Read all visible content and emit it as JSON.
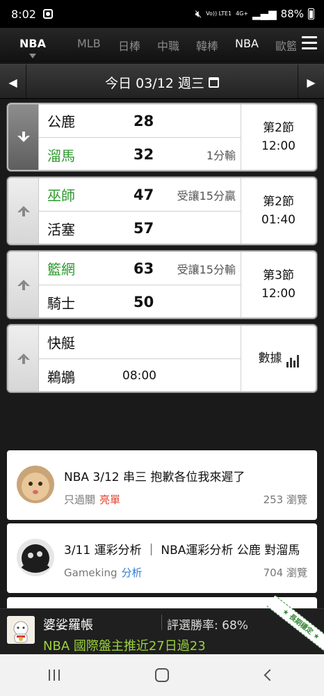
{
  "status_bar": {
    "time": "8:02",
    "volte": "Vo)) LTE1",
    "network": "4G+",
    "battery": "88%"
  },
  "league_tabs": [
    "NBA",
    "MLB",
    "日棒",
    "中職",
    "韓棒",
    "NBA",
    "歐籃"
  ],
  "date_bar": {
    "label": "今日 03/12 週三"
  },
  "games": [
    {
      "arrow": "down",
      "top": {
        "name": "公鹿",
        "score": "28",
        "note": "",
        "color": "#111111"
      },
      "bottom": {
        "name": "溜馬",
        "score": "32",
        "note": "1分輸",
        "color": "#2f9a2f"
      },
      "status_line1": "第2節",
      "status_line2": "12:00"
    },
    {
      "arrow": "up",
      "top": {
        "name": "巫師",
        "score": "47",
        "note": "受讓15分贏",
        "color": "#2f9a2f"
      },
      "bottom": {
        "name": "活塞",
        "score": "57",
        "note": "",
        "color": "#111111"
      },
      "status_line1": "第2節",
      "status_line2": "01:40"
    },
    {
      "arrow": "up",
      "top": {
        "name": "籃網",
        "score": "63",
        "note": "受讓15分輸",
        "color": "#2f9a2f"
      },
      "bottom": {
        "name": "騎士",
        "score": "50",
        "note": "",
        "color": "#111111"
      },
      "status_line1": "第3節",
      "status_line2": "12:00"
    },
    {
      "arrow": "up",
      "top": {
        "name": "快艇",
        "score": "",
        "note": ""
      },
      "bottom": {
        "name": "鵜鶘",
        "time": "08:00"
      },
      "status_label": "數據"
    }
  ],
  "articles": [
    {
      "title": "NBA 3/12 串三 抱歉各位我來遲了",
      "author": "只過關",
      "tag": "亮單",
      "views": "253 瀏覽"
    },
    {
      "title": "3/11 運彩分析 ｜ NBA運彩分析 公鹿 對溜馬",
      "author": "Gameking",
      "tag": "分析",
      "views": "704 瀏覽"
    }
  ],
  "promo": {
    "name": "婆娑羅帳",
    "rate": "評選勝率: 68%",
    "subtitle": "NBA 國際盤主推近27日過23",
    "ribbon": "★ 長期穩定 ★"
  },
  "colors": {
    "winner_green": "#2f9a2f",
    "tag_red": "#e0442e",
    "tag_blue": "#2e7fd0",
    "promo_green": "#9bd33b"
  }
}
